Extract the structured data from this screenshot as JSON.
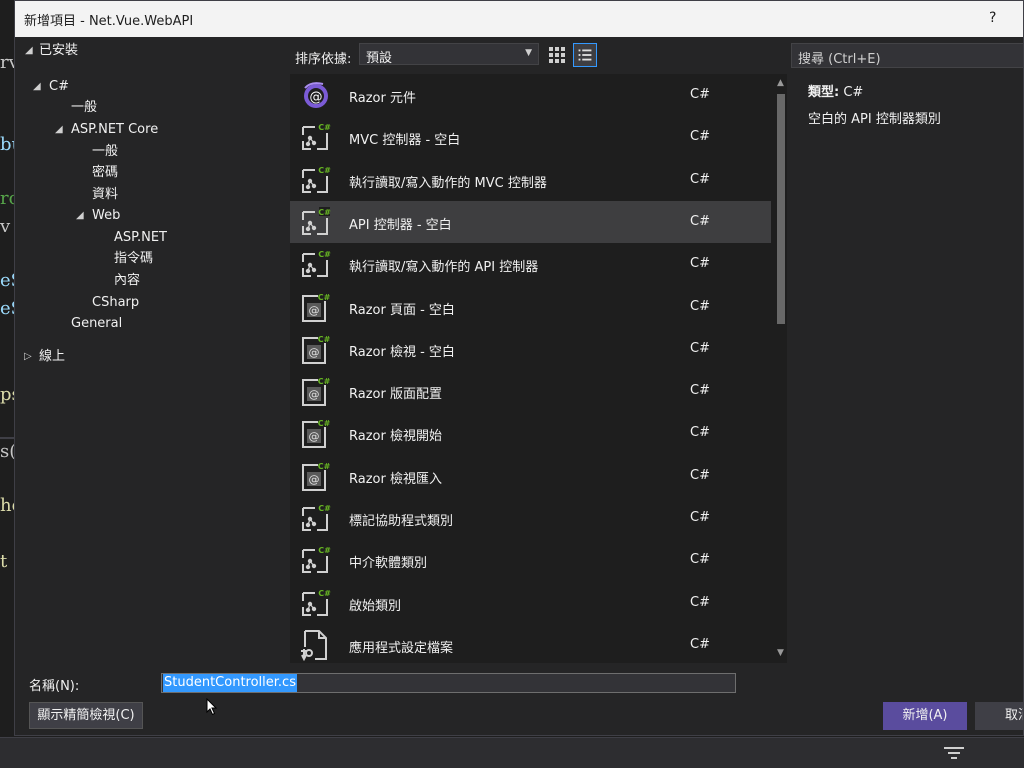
{
  "dialog": {
    "title": "新增項目 - Net.Vue.WebAPI",
    "help": "?"
  },
  "tree": {
    "installed": "已安裝",
    "csharp": "C#",
    "general_cn": "一般",
    "aspnet_core": "ASP.NET Core",
    "general_sub": "一般",
    "code": "密碼",
    "data": "資料",
    "web": "Web",
    "aspnet": "ASP.NET",
    "scripts": "指令碼",
    "content": "內容",
    "csharp2": "CSharp",
    "general_en": "General",
    "online": "線上"
  },
  "sort": {
    "label": "排序依據:",
    "value": "預設"
  },
  "templates": [
    {
      "name": "Razor 元件",
      "lang": "C#",
      "icon": "razor-component-icon"
    },
    {
      "name": "MVC 控制器 - 空白",
      "lang": "C#",
      "icon": "controller-icon"
    },
    {
      "name": "執行讀取/寫入動作的 MVC 控制器",
      "lang": "C#",
      "icon": "controller-icon"
    },
    {
      "name": "API 控制器 - 空白",
      "lang": "C#",
      "icon": "controller-icon"
    },
    {
      "name": "執行讀取/寫入動作的 API 控制器",
      "lang": "C#",
      "icon": "controller-icon"
    },
    {
      "name": "Razor 頁面 - 空白",
      "lang": "C#",
      "icon": "razor-page-icon"
    },
    {
      "name": "Razor 檢視 - 空白",
      "lang": "C#",
      "icon": "razor-page-icon"
    },
    {
      "name": "Razor 版面配置",
      "lang": "C#",
      "icon": "razor-page-icon"
    },
    {
      "name": "Razor 檢視開始",
      "lang": "C#",
      "icon": "razor-page-icon"
    },
    {
      "name": "Razor 檢視匯入",
      "lang": "C#",
      "icon": "razor-page-icon"
    },
    {
      "name": "標記協助程式類別",
      "lang": "C#",
      "icon": "controller-icon"
    },
    {
      "name": "中介軟體類別",
      "lang": "C#",
      "icon": "controller-icon"
    },
    {
      "name": "啟始類別",
      "lang": "C#",
      "icon": "controller-icon"
    },
    {
      "name": "應用程式設定檔案",
      "lang": "C#",
      "icon": "settings-file-icon"
    }
  ],
  "search": {
    "placeholder": "搜尋 (Ctrl+E)"
  },
  "details": {
    "type_key": "類型:",
    "type_value": "C#",
    "description": "空白的 API 控制器類別"
  },
  "form": {
    "name_label": "名稱(N):",
    "name_value": "StudentController.cs",
    "compact_button": "顯示精簡檢視(C)",
    "add_button": "新增(A)",
    "cancel_button": "取消"
  },
  "colors": {
    "accent": "#5a4c9e",
    "selection": "#3399ff",
    "csharp_badge": "#68b723"
  }
}
